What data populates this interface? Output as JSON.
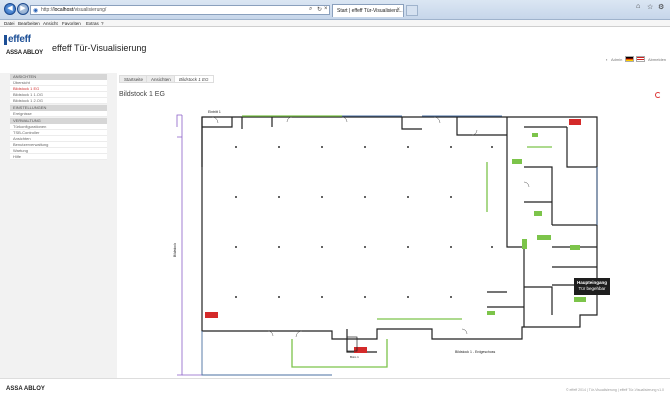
{
  "browser": {
    "url_prefix": "http://",
    "url_host": "localhost",
    "url_path": "/visualisierung/",
    "tab_title": "Start | effeff Tür-Visualisieru...",
    "tab_close": "×",
    "url_search_glyph": "⌕",
    "url_refresh_glyph": "↻",
    "url_stop_glyph": "×",
    "back_glyph": "◀",
    "forward_glyph": "▶",
    "home_glyph": "⌂",
    "star_glyph": "☆",
    "gear_glyph": "⚙",
    "menu": [
      "Datei",
      "Bearbeiten",
      "Ansicht",
      "Favoriten",
      "Extras",
      "?"
    ]
  },
  "header": {
    "logo_effeff": "effeff",
    "logo_assa": "ASSA ABLOY",
    "title": "effeff Tür-Visualisierung",
    "admin_label": "Admin",
    "logout_label": "Abmelden",
    "colors": {
      "brand": "#1d4f96"
    }
  },
  "sidebar": {
    "sections": [
      {
        "heading": "ANSICHTEN",
        "items": [
          {
            "label": "Übersicht",
            "active": false
          },
          {
            "label": "Bildstock 1 EG",
            "active": true
          },
          {
            "label": "Bildstock 1 1.OG",
            "active": false
          },
          {
            "label": "Bildstock 1 2.OG",
            "active": false
          }
        ]
      },
      {
        "heading": "EINSTELLUNGEN",
        "items": [
          {
            "label": "Ereignisse",
            "active": false
          }
        ]
      },
      {
        "heading": "VERWALTUNG",
        "items": [
          {
            "label": "Türkonfigurationen",
            "active": false
          },
          {
            "label": "TSB-Controller",
            "active": false
          },
          {
            "label": "Ansichten",
            "active": false
          },
          {
            "label": "Benutzerverwaltung",
            "active": false
          },
          {
            "label": "Wartung",
            "active": false
          },
          {
            "label": "Hilfe",
            "active": false
          }
        ]
      }
    ]
  },
  "main": {
    "tabs": [
      "Startseite",
      "Ansichten",
      "Bildstock 1 EG"
    ],
    "heading": "Bildstock 1 EG",
    "floorplan": {
      "label_top": "Eintritt 1",
      "label_left": "Bildstock",
      "label_bottom": "Bildstock 1 - Erdgeschoss",
      "label_bottom_small": "Büro 1",
      "tooltip_title": "Haupteingang",
      "tooltip_status": "Tür begehbar",
      "colors": {
        "alarm": "#d42a2a",
        "ok": "#7cc44a",
        "wall": "#222222",
        "outline": "#8a5fc8",
        "blue_wall": "#4a6fa0"
      }
    }
  },
  "footer": {
    "logo": "ASSA ABLOY",
    "copyright": "© effeff 2014 | Tür-Visualisierung | effeff Tür-Visualisierung v1.0"
  }
}
